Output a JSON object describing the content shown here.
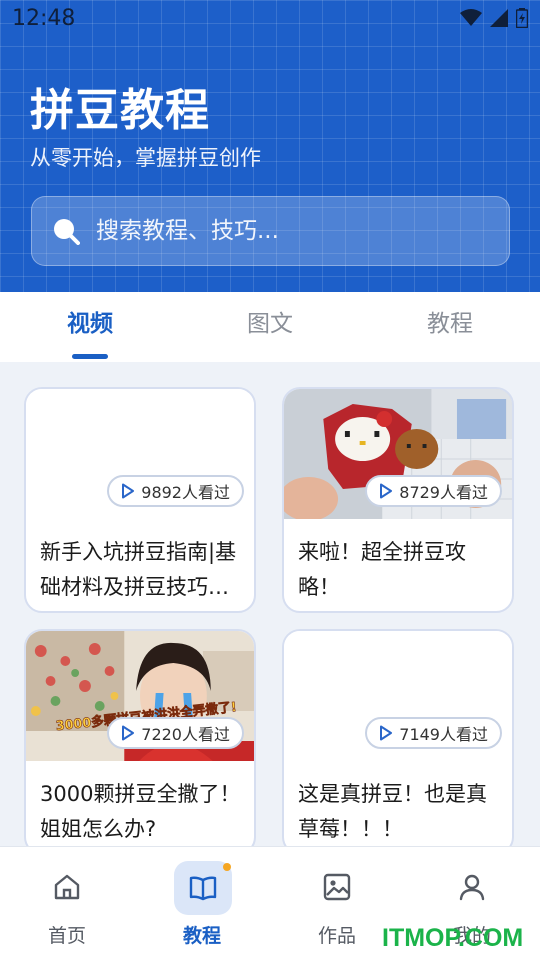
{
  "status_bar": {
    "time": "12:48"
  },
  "hero": {
    "title": "拼豆教程",
    "subtitle": "从零开始，掌握拼豆创作",
    "search_placeholder": "搜索教程、技巧..."
  },
  "tabs": [
    {
      "label": "视频",
      "active": true
    },
    {
      "label": "图文",
      "active": false
    },
    {
      "label": "教程",
      "active": false
    }
  ],
  "videos": [
    {
      "views": "9892人看过",
      "title": "新手入坑拼豆指南|基础材料及拼豆技巧分享",
      "thumb": "blank"
    },
    {
      "views": "8729人看过",
      "title": "来啦！超全拼豆攻略！",
      "thumb": "hello-kitty-bead-photo"
    },
    {
      "views": "7220人看过",
      "title": "3000颗拼豆全撒了！姐姐怎么办?",
      "thumb": "girl-crying-photo"
    },
    {
      "views": "7149人看过",
      "title": "这是真拼豆！也是真草莓！！！",
      "thumb": "blank"
    }
  ],
  "bottom_nav": [
    {
      "label": "首页",
      "icon": "home-icon",
      "active": false
    },
    {
      "label": "教程",
      "icon": "book-icon",
      "active": true
    },
    {
      "label": "作品",
      "icon": "image-icon",
      "active": false
    },
    {
      "label": "我的",
      "icon": "user-icon",
      "active": false
    }
  ],
  "watermark": "ITMOP.COM",
  "colors": {
    "primary": "#1a5fc4",
    "hero_bg": "#1d5fc9",
    "badge_dot": "#f5a623"
  }
}
